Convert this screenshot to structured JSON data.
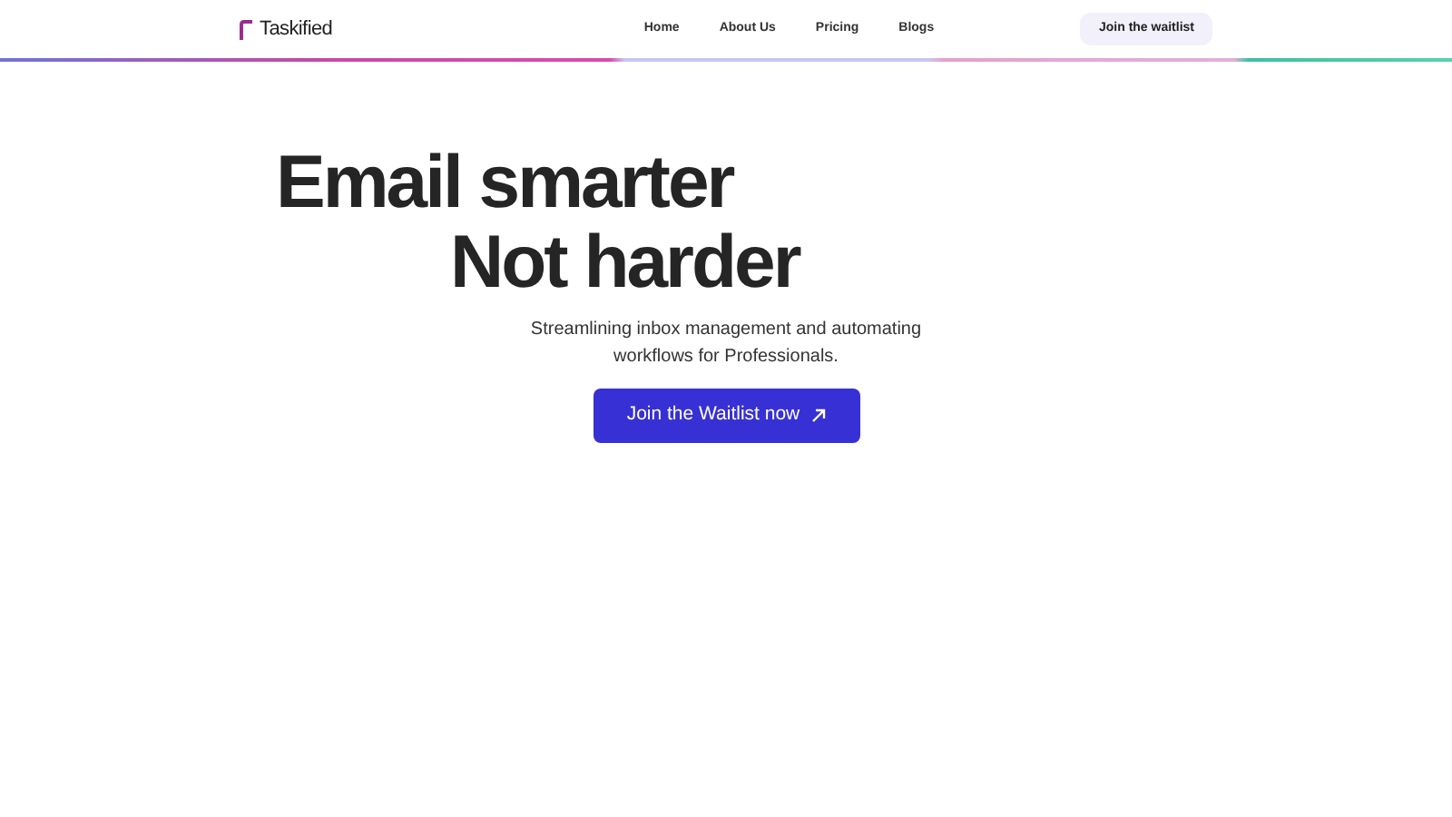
{
  "brand": "Taskified",
  "nav": [
    "Home",
    "About Us",
    "Pricing",
    "Blogs"
  ],
  "cta_top": "Join the waitlist",
  "headline": [
    "Email smarter",
    "Not harder"
  ],
  "subtitle": "Streamlining inbox management and automating workflows for Professionals.",
  "cta_main": "Join the Waitlist now"
}
